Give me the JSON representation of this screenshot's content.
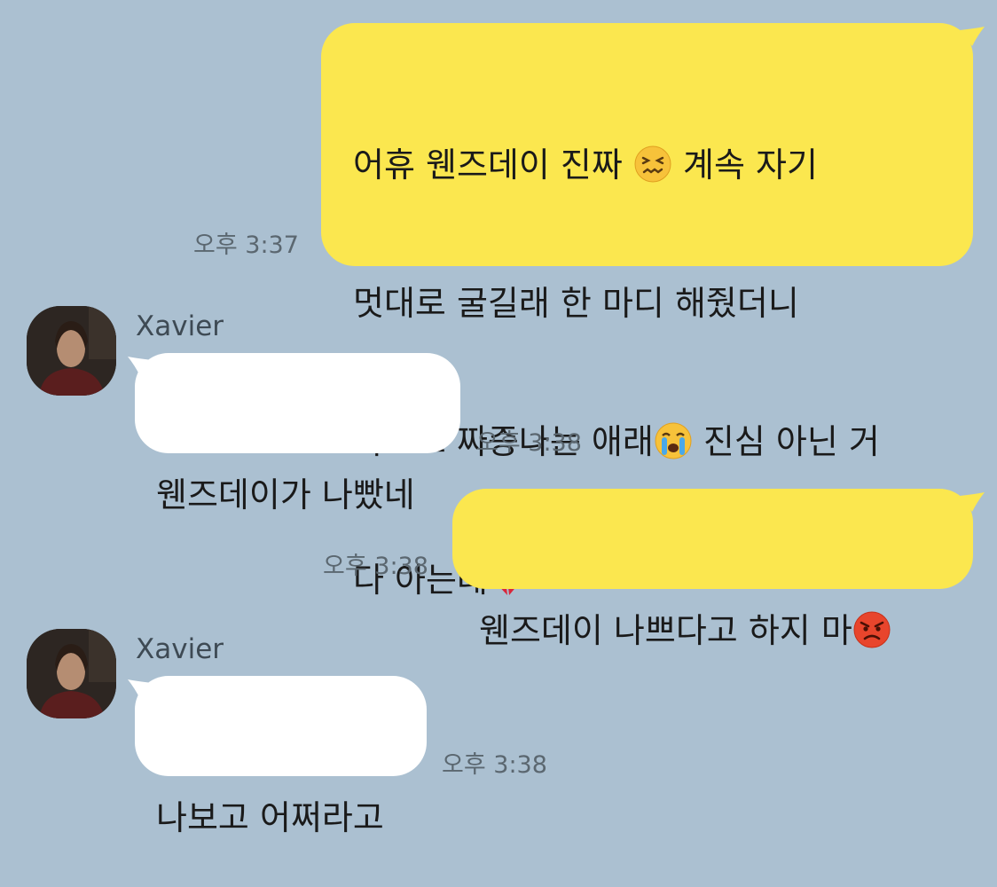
{
  "chat": {
    "messages": [
      {
        "from": "me",
        "parts": {
          "l1a": "어휴 웬즈데이 진짜",
          "l1b": " 계속 자기",
          "l2": "멋대로 굴길래 한 마디 해줬더니",
          "l3a": "나보고 짜증나는 애래",
          "l3b": " 진심 아닌 거",
          "l4": "다 아는데"
        },
        "emojis": [
          "confounded-face",
          "loudly-crying-face",
          "broken-heart"
        ],
        "time": "오후 3:37"
      },
      {
        "from": "Xavier",
        "sender": "Xavier",
        "text": "웬즈데이가 나빴네",
        "time": "오후 3:38"
      },
      {
        "from": "me",
        "text": "웬즈데이 나쁘다고 하지 마",
        "emojis": [
          "pouting-face"
        ],
        "time": "오후 3:38"
      },
      {
        "from": "Xavier",
        "sender": "Xavier",
        "text": "나보고 어쩌라고",
        "time": "오후 3:38"
      }
    ]
  },
  "colors": {
    "background": "#abc0d1",
    "my_bubble": "#fbe74f",
    "their_bubble": "#ffffff",
    "timestamp": "#5b6770"
  }
}
